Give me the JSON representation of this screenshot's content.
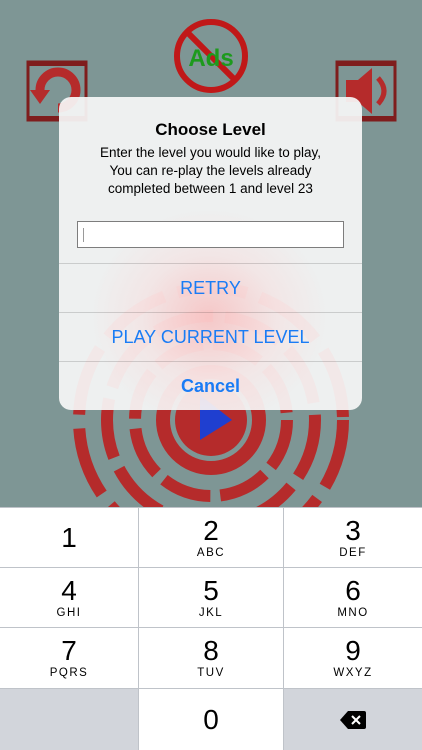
{
  "game": {
    "ads_label": "Ads",
    "colors": {
      "background": "#7e9695",
      "red": "#b52b2b",
      "dark_red": "#7f1d1d",
      "blue": "#1f3fd0"
    }
  },
  "dialog": {
    "title": "Choose Level",
    "message": [
      "Enter the level you would like to play,",
      "You can re-play the levels already",
      "completed between 1 and level 23"
    ],
    "input_value": "",
    "input_placeholder": "",
    "buttons": {
      "retry": "RETRY",
      "play_current": "PLAY CURRENT LEVEL",
      "cancel": "Cancel"
    },
    "accent_color": "#1a7cf5"
  },
  "keyboard": {
    "keys": [
      {
        "digit": "1",
        "letters": ""
      },
      {
        "digit": "2",
        "letters": "ABC"
      },
      {
        "digit": "3",
        "letters": "DEF"
      },
      {
        "digit": "4",
        "letters": "GHI"
      },
      {
        "digit": "5",
        "letters": "JKL"
      },
      {
        "digit": "6",
        "letters": "MNO"
      },
      {
        "digit": "7",
        "letters": "PQRS"
      },
      {
        "digit": "8",
        "letters": "TUV"
      },
      {
        "digit": "9",
        "letters": "WXYZ"
      },
      {
        "digit": "0",
        "letters": ""
      }
    ],
    "delete_icon": "backspace-icon"
  }
}
